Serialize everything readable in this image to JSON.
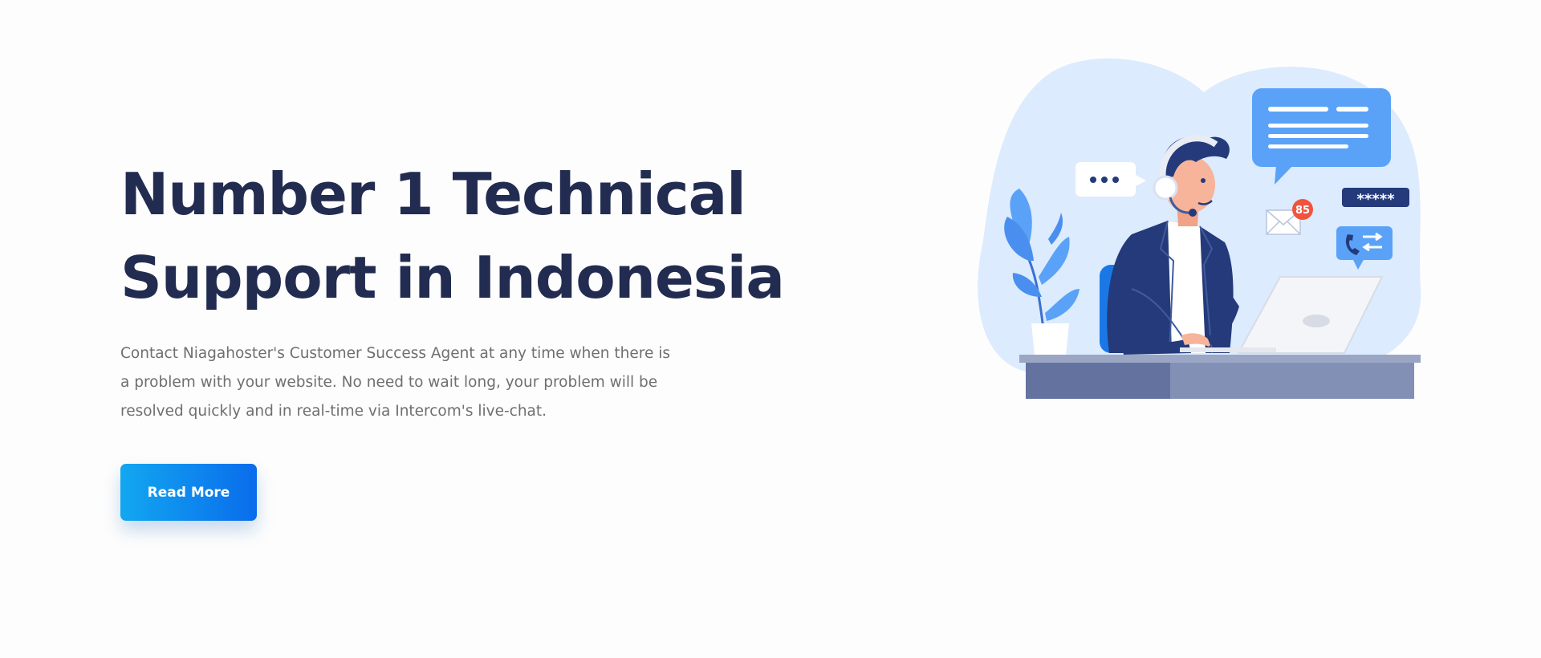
{
  "hero": {
    "title_lines": [
      "Number 1 Technical",
      "Support in Indonesia"
    ],
    "description_lines": [
      "Contact Niagahoster's Customer Success Agent at any time when there is",
      "a problem with your website. No need to wait long, your problem will be",
      "resolved quickly and in real-time via Intercom's live-chat."
    ],
    "cta_label": "Read More"
  },
  "illustration": {
    "mail_badge_count": "85",
    "password_mask": "*****",
    "colors": {
      "blob": "#dcebfd",
      "accent_blue": "#5aa2f7",
      "navy": "#243a7a",
      "desk_top": "#9aa6c4",
      "desk_front": "#6472a0"
    }
  },
  "colors": {
    "title": "#222c50",
    "body_text": "#6f6f6f",
    "button_gradient_start": "#12a7f0",
    "button_gradient_end": "#0a6cec"
  }
}
